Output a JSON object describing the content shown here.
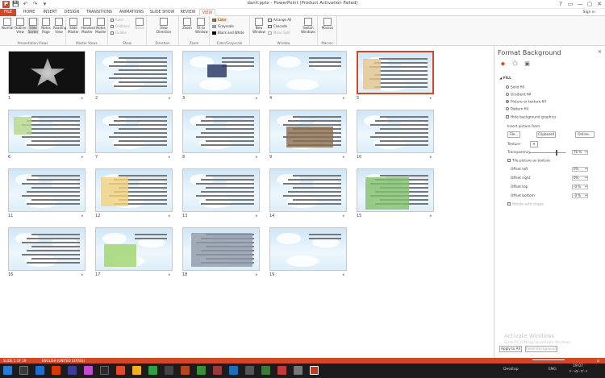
{
  "window": {
    "title": "danil.pptx - PowerPoint (Product Activation Failed)",
    "controls": [
      "?",
      "▭",
      "—",
      "▢",
      "✕"
    ]
  },
  "qat": {
    "app": "P",
    "save": "💾",
    "undo": "↶",
    "redo": "↷",
    "more": "▾"
  },
  "tabs": [
    "FILE",
    "HOME",
    "INSERT",
    "DESIGN",
    "TRANSITIONS",
    "ANIMATIONS",
    "SLIDE SHOW",
    "REVIEW",
    "VIEW"
  ],
  "active_tab": "VIEW",
  "signin": "Sign in",
  "ribbon": {
    "presentation_views": {
      "label": "Presentation Views",
      "buttons": [
        "Normal",
        "Outline View",
        "Slide Sorter",
        "Notes Page",
        "Reading View"
      ]
    },
    "master_views": {
      "label": "Master Views",
      "buttons": [
        "Slide Master",
        "Handout Master",
        "Notes Master"
      ]
    },
    "show": {
      "label": "Show",
      "items": [
        "Ruler",
        "Gridlines",
        "Guides"
      ],
      "notes": "Notes"
    },
    "direction": {
      "label": "Direction",
      "button": "View Direction"
    },
    "zoom": {
      "label": "Zoom",
      "buttons": [
        "Zoom",
        "Fit to Window"
      ]
    },
    "color": {
      "label": "Color/Grayscale",
      "items": [
        "Color",
        "Grayscale",
        "Black and White"
      ]
    },
    "window": {
      "label": "Window",
      "new_window": "New Window",
      "items": [
        "Arrange All",
        "Cascade",
        "Move Split"
      ],
      "switch": "Switch Windows"
    },
    "macros": {
      "label": "Macros",
      "button": "Macros"
    }
  },
  "slides": [
    {
      "n": "1"
    },
    {
      "n": "2"
    },
    {
      "n": "3"
    },
    {
      "n": "4"
    },
    {
      "n": "5"
    },
    {
      "n": "6"
    },
    {
      "n": "7"
    },
    {
      "n": "8"
    },
    {
      "n": "9"
    },
    {
      "n": "10"
    },
    {
      "n": "11"
    },
    {
      "n": "12"
    },
    {
      "n": "13"
    },
    {
      "n": "14"
    },
    {
      "n": "15"
    },
    {
      "n": "16"
    },
    {
      "n": "17"
    },
    {
      "n": "18"
    },
    {
      "n": "19"
    }
  ],
  "selected_slide": 5,
  "format_pane": {
    "title": "Format Background",
    "section": "FILL",
    "fill_options": [
      "Solid fill",
      "Gradient fill",
      "Picture or texture fill",
      "Pattern fill"
    ],
    "selected_fill": "Picture or texture fill",
    "hide_bg": "Hide background graphics",
    "insert_from": "Insert picture from",
    "buttons": {
      "file": "File...",
      "clipboard": "Clipboard",
      "online": "Online..."
    },
    "texture": "Texture",
    "transparency": {
      "label": "Transparency",
      "value": "76 %",
      "percent": 76
    },
    "tile": "Tile picture as texture",
    "offsets": [
      {
        "label": "Offset left",
        "value": "0%"
      },
      {
        "label": "Offset right",
        "value": "0%"
      },
      {
        "label": "Offset top",
        "value": "-0 %"
      },
      {
        "label": "Offset bottom",
        "value": "-0 %"
      }
    ],
    "rotate": "Rotate with shape",
    "apply_all": "Apply to All",
    "reset": "Reset Background",
    "watermark_title": "Activate Windows",
    "watermark_sub": "Go to PC settings to activate Windows."
  },
  "status": {
    "slide": "SLIDE 5 OF 19",
    "lang": "ENGLISH (UNITED STATES)"
  },
  "taskbar": {
    "desktop": "Desktop",
    "lang": "ENG",
    "time": "19:07",
    "date": "۲۰۱۵/۰۳/۰۶"
  }
}
